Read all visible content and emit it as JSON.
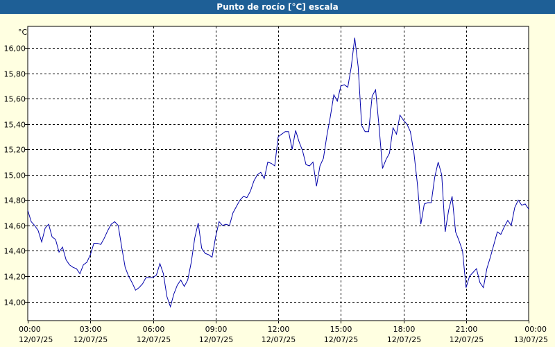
{
  "title": "Punto de rocío [°C] escala",
  "colors": {
    "title_bar": "#1e5f96",
    "background": "#ffffe1",
    "plot_background": "#ffffff",
    "series": "#0000aa",
    "grid": "#000000"
  },
  "chart_data": {
    "type": "line",
    "title": "Punto de rocío [°C] escala",
    "ylabel": "°C",
    "xlabel": "",
    "ylim": [
      13.85,
      16.17
    ],
    "xlim": [
      "12/07/25 00:00",
      "13/07/25 00:00"
    ],
    "grid": true,
    "y_ticks": [
      "14,00",
      "14,20",
      "14,40",
      "14,60",
      "14,80",
      "15,00",
      "15,20",
      "15,40",
      "15,60",
      "15,80",
      "16,00"
    ],
    "x_ticks": [
      {
        "time": "00:00",
        "date": "12/07/25"
      },
      {
        "time": "03:00",
        "date": "12/07/25"
      },
      {
        "time": "06:00",
        "date": "12/07/25"
      },
      {
        "time": "09:00",
        "date": "12/07/25"
      },
      {
        "time": "12:00",
        "date": "12/07/25"
      },
      {
        "time": "15:00",
        "date": "12/07/25"
      },
      {
        "time": "18:00",
        "date": "12/07/25"
      },
      {
        "time": "21:00",
        "date": "12/07/25"
      },
      {
        "time": "00:00",
        "date": "13/07/25"
      }
    ],
    "series": [
      {
        "times": [
          "00:00",
          "00:10",
          "00:20",
          "00:30",
          "00:40",
          "00:50",
          "01:00",
          "01:10",
          "01:20",
          "01:30",
          "01:40",
          "01:50",
          "02:00",
          "02:10",
          "02:20",
          "02:30",
          "02:40",
          "02:50",
          "03:00",
          "03:10",
          "03:20",
          "03:30",
          "03:40",
          "03:50",
          "04:00",
          "04:10",
          "04:20",
          "04:30",
          "04:40",
          "04:50",
          "05:00",
          "05:10",
          "05:20",
          "05:30",
          "05:40",
          "05:50",
          "06:00",
          "06:10",
          "06:20",
          "06:30",
          "06:40",
          "06:50",
          "07:00",
          "07:10",
          "07:20",
          "07:30",
          "07:40",
          "07:50",
          "08:00",
          "08:10",
          "08:20",
          "08:30",
          "08:40",
          "08:50",
          "09:00",
          "09:10",
          "09:20",
          "09:30",
          "09:40",
          "09:50",
          "10:00",
          "10:10",
          "10:20",
          "10:30",
          "10:40",
          "10:50",
          "11:00",
          "11:10",
          "11:20",
          "11:30",
          "11:40",
          "11:50",
          "12:00",
          "12:10",
          "12:20",
          "12:30",
          "12:40",
          "12:50",
          "13:00",
          "13:10",
          "13:20",
          "13:30",
          "13:40",
          "13:50",
          "14:00",
          "14:10",
          "14:20",
          "14:30",
          "14:40",
          "14:50",
          "15:00",
          "15:10",
          "15:20",
          "15:30",
          "15:40",
          "15:50",
          "16:00",
          "16:10",
          "16:20",
          "16:30",
          "16:40",
          "16:50",
          "17:00",
          "17:10",
          "17:20",
          "17:30",
          "17:40",
          "17:50",
          "18:00",
          "18:10",
          "18:20",
          "18:30",
          "18:40",
          "18:50",
          "19:00",
          "19:10",
          "19:20",
          "19:30",
          "19:40",
          "19:50",
          "20:00",
          "20:10",
          "20:20",
          "20:30",
          "20:40",
          "20:50",
          "21:00",
          "21:10",
          "21:20",
          "21:30",
          "21:40",
          "21:50",
          "22:00",
          "22:10",
          "22:20",
          "22:30",
          "22:40",
          "22:50",
          "23:00",
          "23:10",
          "23:20",
          "23:30",
          "23:40",
          "23:50",
          "24:00"
        ],
        "values": [
          14.72,
          14.63,
          14.6,
          14.56,
          14.47,
          14.58,
          14.61,
          14.51,
          14.49,
          14.39,
          14.43,
          14.33,
          14.29,
          14.27,
          14.26,
          14.22,
          14.29,
          14.31,
          14.37,
          14.46,
          14.46,
          14.45,
          14.5,
          14.56,
          14.61,
          14.63,
          14.6,
          14.43,
          14.27,
          14.2,
          14.15,
          14.09,
          14.11,
          14.14,
          14.19,
          14.19,
          14.19,
          14.21,
          14.3,
          14.22,
          14.04,
          13.96,
          14.06,
          14.13,
          14.17,
          14.12,
          14.17,
          14.31,
          14.5,
          14.62,
          14.42,
          14.38,
          14.37,
          14.35,
          14.51,
          14.63,
          14.6,
          14.61,
          14.6,
          14.7,
          14.75,
          14.8,
          14.83,
          14.82,
          14.87,
          14.95,
          15.0,
          15.02,
          14.97,
          15.1,
          15.09,
          15.07,
          15.3,
          15.32,
          15.34,
          15.34,
          15.2,
          15.35,
          15.26,
          15.19,
          15.08,
          15.07,
          15.1,
          14.91,
          15.07,
          15.13,
          15.31,
          15.46,
          15.63,
          15.58,
          15.7,
          15.71,
          15.69,
          15.85,
          16.08,
          15.85,
          15.39,
          15.34,
          15.34,
          15.62,
          15.67,
          15.38,
          15.05,
          15.12,
          15.17,
          15.37,
          15.32,
          15.47,
          15.43,
          15.4,
          15.34,
          15.18,
          14.93,
          14.61,
          14.77,
          14.78,
          14.78,
          14.98,
          15.1,
          15.0,
          14.55,
          14.72,
          14.83,
          14.55,
          14.48,
          14.4,
          14.11,
          14.2,
          14.23,
          14.26,
          14.15,
          14.11,
          14.26,
          14.35,
          14.45,
          14.55,
          14.53,
          14.59,
          14.64,
          14.6,
          14.74,
          14.8,
          14.76,
          14.77,
          14.73
        ]
      }
    ]
  }
}
